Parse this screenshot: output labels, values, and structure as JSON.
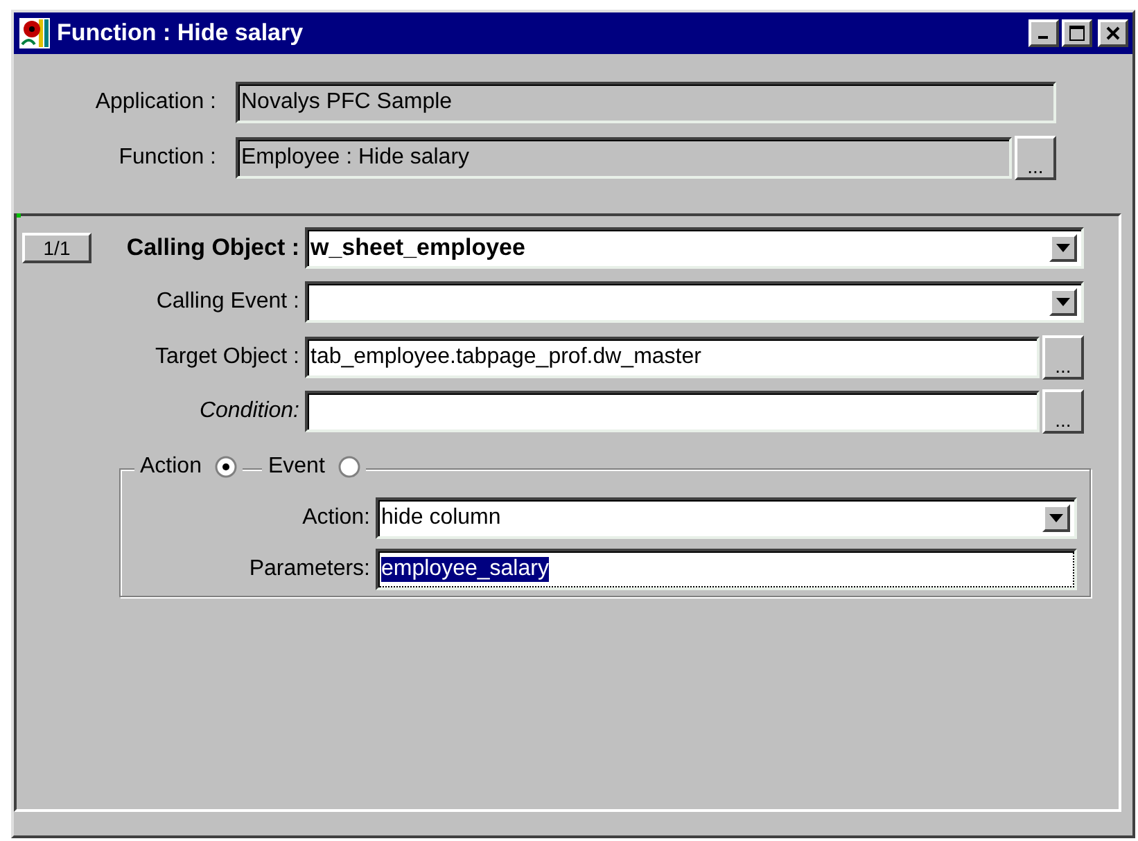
{
  "window": {
    "title": "Function : Hide salary"
  },
  "header_fields": [
    {
      "label": "Application :",
      "value": "Novalys PFC Sample"
    },
    {
      "label": "Function :",
      "value": "Employee : Hide salary",
      "button": "..."
    }
  ],
  "record_counter": "1/1",
  "fields": [
    {
      "label": "Calling Object :",
      "value": "w_sheet_employee",
      "kind": "dropdown",
      "bold": true,
      "italic": false
    },
    {
      "label": "Calling Event :",
      "kind": "dropdown",
      "bold": false,
      "italic": false
    },
    {
      "label": "Target Object :",
      "value": "tab_employee.tabpage_prof.dw_master",
      "kind": "browse",
      "button": "...",
      "bold": false,
      "italic": false
    },
    {
      "label": "Condition:",
      "kind": "browse",
      "button": "...",
      "bold": false,
      "italic": true
    }
  ],
  "modes": [
    {
      "label": "Action",
      "selected": true
    },
    {
      "label": "Event",
      "selected": false
    }
  ],
  "action_fields": [
    {
      "label": "Action:",
      "value": "hide column",
      "kind": "dropdown",
      "focused": false
    },
    {
      "label": "Parameters:",
      "value": "employee_salary",
      "kind": "text",
      "focused": true
    }
  ]
}
